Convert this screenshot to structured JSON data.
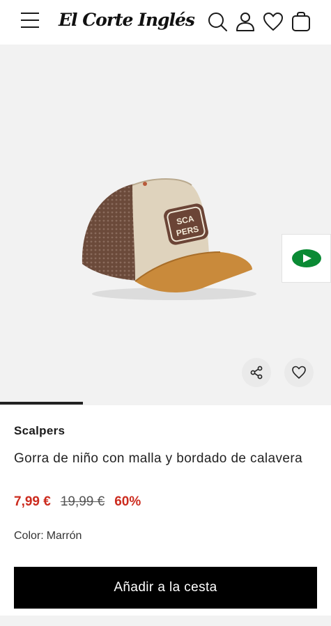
{
  "header": {
    "logo_text": "El Corte Inglés",
    "icons": [
      "menu-icon",
      "search-icon",
      "user-icon",
      "heart-icon",
      "bag-icon"
    ]
  },
  "gallery": {
    "image_badge_text": "SCALPERS",
    "progress_fraction": 0.25,
    "icons": [
      "share-icon",
      "heart-icon",
      "arrow-right-icon"
    ],
    "accent_green": "#0a8a34"
  },
  "product": {
    "brand": "Scalpers",
    "title": "Gorra de niño con malla y bordado de calavera",
    "price_now": "7,99 €",
    "price_old": "19,99 €",
    "discount": "60%",
    "color_label": "Color:",
    "color_value": "Marrón"
  },
  "cta": {
    "label": "Añadir a la cesta"
  },
  "colors": {
    "price_red": "#cc2c1f",
    "cta_bg": "#000000"
  }
}
